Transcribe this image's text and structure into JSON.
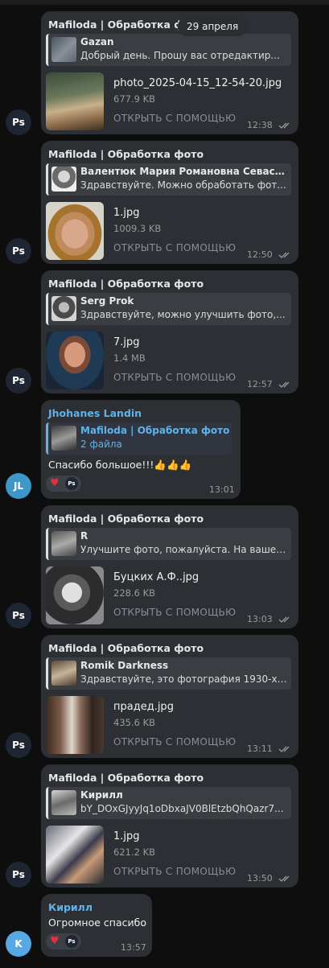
{
  "date_pill": "29 апреля",
  "avatar_ps": "Ps",
  "open_with": "ОТКРЫТЬ С ПОМОЩЬЮ",
  "messages": [
    {
      "sender": "Mafiloda | Обработка фото",
      "reply_name": "Gazan",
      "reply_text": "Добрый день. Прошу вас отредактир...",
      "file_name": "photo_2025-04-15_12-54-20.jpg",
      "file_size": "677.9 KB",
      "time": "12:38"
    },
    {
      "sender": "Mafiloda | Обработка фото",
      "reply_name": "Валентюк Мария Романовна Севаст...",
      "reply_text": "Здравствуйте. Можно обработать фот...",
      "file_name": "1.jpg",
      "file_size": "1009.3 KB",
      "time": "12:50"
    },
    {
      "sender": "Mafiloda | Обработка фото",
      "reply_name": "Serg Prok",
      "reply_text": "Здравствуйте, можно улучшить фото,...",
      "file_name": "7.jpg",
      "file_size": "1.4 MB",
      "time": "12:57"
    },
    {
      "sender": "Mafiloda | Обработка фото",
      "reply_name": "R",
      "reply_text": "Улучшите фото, пожалуйста. На ваше ...",
      "file_name": "Буцких А.Ф..jpg",
      "file_size": "228.6 KB",
      "time": "13:03"
    },
    {
      "sender": "Mafiloda | Обработка фото",
      "reply_name": "Romik Darkness",
      "reply_text": "Здравствуйте, это фотография 1930-х, ...",
      "file_name": "прадед.jpg",
      "file_size": "435.6 KB",
      "time": "13:11"
    },
    {
      "sender": "Mafiloda | Обработка фото",
      "reply_name": "Кирилл",
      "reply_text": "bY_DOxGJyyJq1oDbxaJV0BlEtzbQhQazr7...",
      "file_name": "1.jpg",
      "file_size": "621.2 KB",
      "time": "13:50"
    }
  ],
  "thanks_msg": {
    "sender": "Jhohanes Landin",
    "avatar": "JL",
    "reply_name": "Mafiloda | Обработка фото",
    "reply_text": "2 файла",
    "text": "Спасибо большое!!!👍👍👍",
    "time": "13:01"
  },
  "kirill_msg": {
    "sender": "Кирилл",
    "avatar": "K",
    "text": "Огромное спасибо",
    "time": "13:57"
  },
  "reaction": {
    "emoji": "♥",
    "by": "Ps"
  },
  "colors": {
    "bubble": "#2c2f33",
    "background": "#0e0e0e",
    "accent": "#5eb3ec",
    "heart": "#e0303f"
  }
}
